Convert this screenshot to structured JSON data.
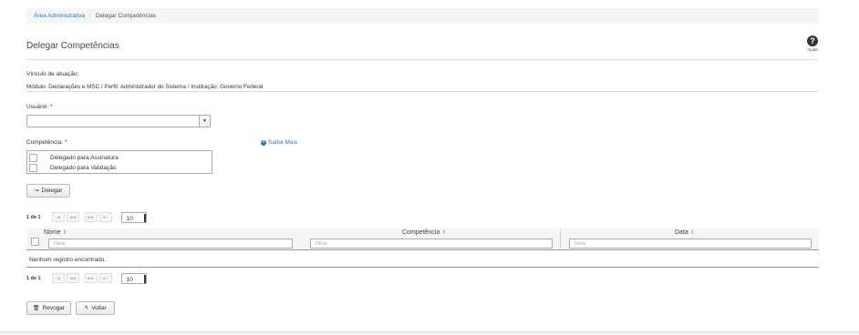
{
  "breadcrumb": {
    "home": "Área Administrativa",
    "current": "Delegar Competências"
  },
  "title": "Delegar Competências",
  "help": {
    "label": "Ajuda",
    "icon": "question-circle-icon"
  },
  "vinculo": {
    "label": "Vínculo de atuação:",
    "value": "Módulo: Declarações e MSC / Perfil: Administrador do Sistema / Instituição: Governo Federal"
  },
  "usuario": {
    "label": "Usuário: *",
    "value": ""
  },
  "competencia": {
    "label": "Competência: *",
    "options": [
      "Delegado para Assinatura",
      "Delegado para Validação"
    ]
  },
  "saiba_mais": "Saiba Mais",
  "delegar_button": "Delegar",
  "pager": {
    "count": "1 de 1",
    "buttons": [
      "|◀",
      "◀◀",
      "▶▶",
      "▶|"
    ],
    "rows_per_page": "10"
  },
  "table": {
    "columns": [
      {
        "label": "Nome",
        "filter_placeholder": "Filtrar"
      },
      {
        "label": "Competência",
        "filter_placeholder": "Filtrar"
      },
      {
        "label": "Data",
        "filter_placeholder": "Filtrar"
      }
    ],
    "empty_message": "Nenhum registro encontrado."
  },
  "revogar_button": "Revogar",
  "voltar_button": "Voltar"
}
